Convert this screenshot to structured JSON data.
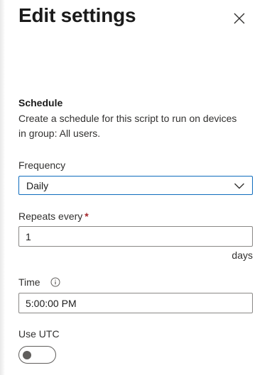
{
  "panel": {
    "title": "Edit settings",
    "close_icon": "close-icon"
  },
  "schedule": {
    "heading": "Schedule",
    "description": "Create a schedule for this script to run on devices in group: All users."
  },
  "frequency": {
    "label": "Frequency",
    "selected": "Daily",
    "icon": "chevron-down-icon"
  },
  "repeats": {
    "label": "Repeats every",
    "required_mark": "*",
    "value": "1",
    "suffix": "days"
  },
  "time": {
    "label": "Time",
    "info_icon": "info-icon",
    "value": "5:00:00 PM"
  },
  "utc": {
    "label": "Use UTC",
    "enabled": false
  },
  "colors": {
    "accent": "#0f6cbd",
    "required": "#a4262c",
    "toggle_off": "#605e5c"
  }
}
